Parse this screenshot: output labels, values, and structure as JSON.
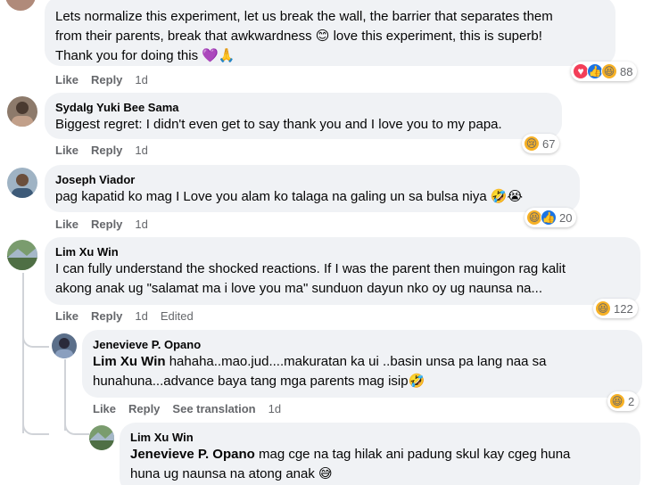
{
  "comments": [
    {
      "id": "c1",
      "name": "",
      "lines": [
        "Lets normalize this experiment, let us break the wall, the barrier that separates them",
        "from their parents, break that awkwardness 😊 love this experiment, this is superb!",
        "Thank you for doing this 💜🙏"
      ],
      "actions": {
        "like": "Like",
        "reply": "Reply",
        "time": "1d"
      },
      "reactions": {
        "icons": [
          "love",
          "like",
          "haha"
        ],
        "count": "88"
      }
    },
    {
      "id": "c2",
      "name": "Sydalg Yuki Bee Sama",
      "lines": [
        "Biggest regret: I didn't even get to say thank you and I love you to my papa."
      ],
      "actions": {
        "like": "Like",
        "reply": "Reply",
        "time": "1d"
      },
      "reactions": {
        "icons": [
          "sad"
        ],
        "count": "67"
      }
    },
    {
      "id": "c3",
      "name": "Joseph Viador",
      "lines": [
        "pag kapatid ko mag I Love you alam ko talaga na galing un sa bulsa niya 🤣😭"
      ],
      "actions": {
        "like": "Like",
        "reply": "Reply",
        "time": "1d"
      },
      "reactions": {
        "icons": [
          "haha",
          "like"
        ],
        "count": "20"
      }
    },
    {
      "id": "c4",
      "name": "Lim Xu Win",
      "lines": [
        "I can fully understand the shocked reactions. If I was the parent then muingon rag kalit",
        "akong anak ug \"salamat ma i love you ma\" sunduon dayun nko oy ug naunsa na..."
      ],
      "actions": {
        "like": "Like",
        "reply": "Reply",
        "time": "1d",
        "edited": "Edited"
      },
      "reactions": {
        "icons": [
          "haha"
        ],
        "count": "122"
      }
    },
    {
      "id": "r1",
      "name": "Jenevieve P. Opano",
      "mention": "Lim Xu Win",
      "lines": [
        " hahaha..mao.jud....makuratan ka ui ..basin unsa pa lang naa sa",
        "hunahuna...advance baya tang mga parents mag isip🤣"
      ],
      "actions": {
        "like": "Like",
        "reply": "Reply",
        "translate": "See translation",
        "time": "1d"
      },
      "reactions": {
        "icons": [
          "haha"
        ],
        "count": "2"
      }
    },
    {
      "id": "r2",
      "name": "Lim Xu Win",
      "mention": "Jenevieve P. Opano",
      "lines": [
        " mag cge na tag hilak ani padung skul kay cgeg huna",
        "huna ug naunsa na atong anak 😅"
      ]
    }
  ],
  "colors": {
    "bubble": "#f0f2f5",
    "meta": "#65676b",
    "love": "#f33e58",
    "like": "#1b74e4",
    "haha": "#f7b125"
  }
}
